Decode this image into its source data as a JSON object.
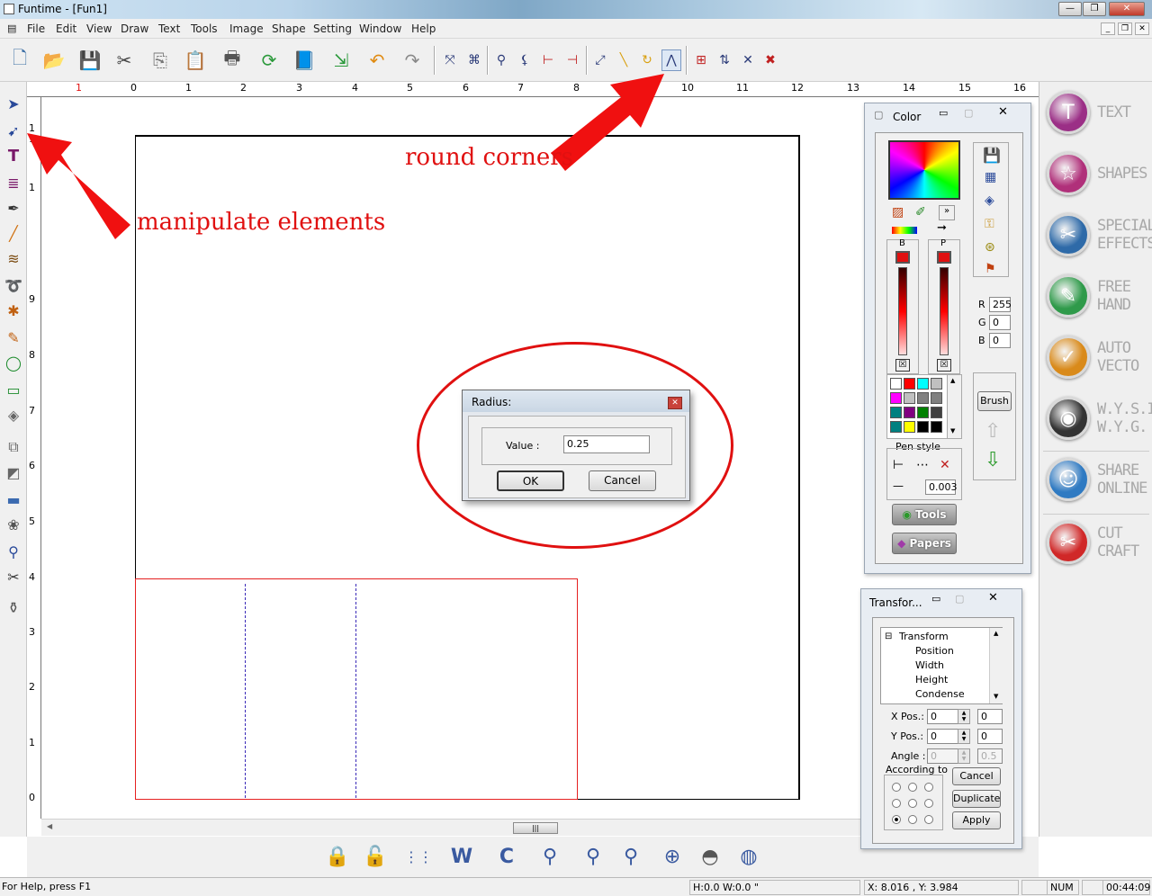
{
  "window": {
    "title": "Funtime - [Fun1]"
  },
  "menu": [
    "File",
    "Edit",
    "View",
    "Draw",
    "Text",
    "Tools",
    "Image",
    "Shape",
    "Setting",
    "Window",
    "Help"
  ],
  "canvas": {
    "annotation_round_corners": "round corners",
    "annotation_manipulate": "manipulate elements"
  },
  "rulers": {
    "horizontal": [
      "1",
      "0",
      "1",
      "2",
      "3",
      "4",
      "5",
      "6",
      "7",
      "8",
      "9",
      "10",
      "11",
      "12",
      "13",
      "14",
      "15",
      "16"
    ],
    "vertical": [
      "1",
      "1",
      "1",
      "9",
      "8",
      "7",
      "6",
      "5",
      "4",
      "3",
      "2",
      "1",
      "0"
    ]
  },
  "radius_dialog": {
    "title": "Radius:",
    "value_label": "Value :",
    "value": "0.25",
    "ok_label": "OK",
    "cancel_label": "Cancel"
  },
  "color_panel": {
    "title": "Color",
    "b_label": "B",
    "p_label": "P",
    "r_label": "R",
    "r_value": "255",
    "g_label": "G",
    "g_value": "0",
    "b2_label": "B",
    "b2_value": "0",
    "brush_label": "Brush",
    "pen_style_label": "Pen style",
    "pen_width": "0.003",
    "tools_label": "Tools",
    "papers_label": "Papers",
    "swatches": [
      "#ffffff",
      "#ff0000",
      "#00ffff",
      "#c0c0c0",
      "#ff00ff",
      "#c0c0c0",
      "#808080",
      "#808080",
      "#008080",
      "#800080",
      "#008000",
      "#404040",
      "#008080",
      "#ffff00",
      "#000000",
      "#000000"
    ]
  },
  "transform_panel": {
    "title": "Transfor...",
    "tree": [
      "Transform",
      "Position",
      "Width",
      "Height",
      "Condense"
    ],
    "xpos_label": "X Pos.:",
    "xpos_value": "0",
    "xpos_value2": "0",
    "ypos_label": "Y Pos.:",
    "ypos_value": "0",
    "ypos_value2": "0",
    "angle_label": "Angle :",
    "angle_value": "0",
    "angle_value2": "0.5",
    "according_label": "According to",
    "cancel_label": "Cancel",
    "duplicate_label": "Duplicate",
    "apply_label": "Apply"
  },
  "right_panel": [
    {
      "label": "TEXT",
      "color": "#9b2f86",
      "icon": "T"
    },
    {
      "label": "SHAPES",
      "color": "#b0307a",
      "icon": "☆"
    },
    {
      "label": "SPECIAL\nEFFECTS",
      "color": "#2e6aa8",
      "icon": "✂"
    },
    {
      "label": "FREE\nHAND",
      "color": "#2f9a4a",
      "icon": "✎"
    },
    {
      "label": "AUTO\nVECTO",
      "color": "#d98a1a",
      "icon": "✓"
    },
    {
      "label": "W.Y.S.I.\nW.Y.G.",
      "color": "#333333",
      "icon": "◉"
    },
    {
      "label": "SHARE\nONLINE",
      "color": "#2f7ac2",
      "icon": "☺"
    },
    {
      "label": "CUT\nCRAFT",
      "color": "#d02828",
      "icon": "✂"
    }
  ],
  "status": {
    "help": "For Help, press F1",
    "dims": "H:0.0   W:0.0 \"",
    "coords": "X: 8.016 , Y: 3.984",
    "num": "NUM",
    "time": "00:44:09"
  }
}
